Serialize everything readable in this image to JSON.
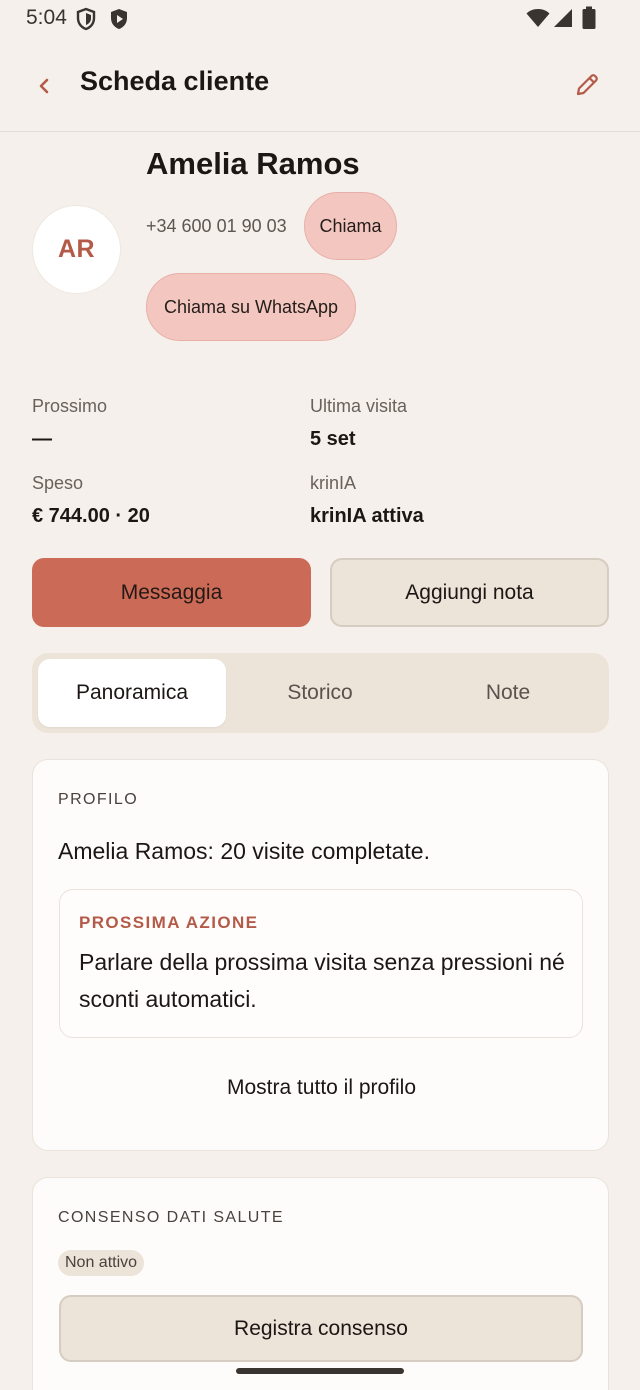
{
  "status_bar": {
    "time": "5:04"
  },
  "header": {
    "title": "Scheda cliente"
  },
  "client": {
    "initials": "AR",
    "name": "Amelia Ramos",
    "phone": "+34 600 01 90 03",
    "call_label": "Chiama",
    "whatsapp_label": "Chiama su WhatsApp"
  },
  "stats": [
    {
      "label": "Prossimo",
      "value": "—"
    },
    {
      "label": "Ultima visita",
      "value": "5 set"
    },
    {
      "label": "Speso",
      "value": "€ 744.00 · 20"
    },
    {
      "label": "krinIA",
      "value": "krinIA attiva"
    }
  ],
  "actions": {
    "message_label": "Messaggia",
    "add_note_label": "Aggiungi nota"
  },
  "tabs": [
    {
      "label": "Panoramica",
      "active": true
    },
    {
      "label": "Storico",
      "active": false
    },
    {
      "label": "Note",
      "active": false
    }
  ],
  "profile_card": {
    "section_label": "PROFILO",
    "summary": "Amelia Ramos: 20 visite completate.",
    "next_action_label": "PROSSIMA AZIONE",
    "next_action_text": "Parlare della prossima visita senza pressioni né sconti automatici.",
    "show_all_label": "Mostra tutto il profilo"
  },
  "consent_card": {
    "section_label": "CONSENSO DATI SALUTE",
    "status_badge": "Non attivo",
    "register_label": "Registra consenso"
  },
  "colors": {
    "accent": "#CB6B57",
    "accent_text": "#B45A48",
    "pill": "#F4C6C0",
    "background": "#F5F0EB",
    "surface": "#ECE4D9"
  }
}
